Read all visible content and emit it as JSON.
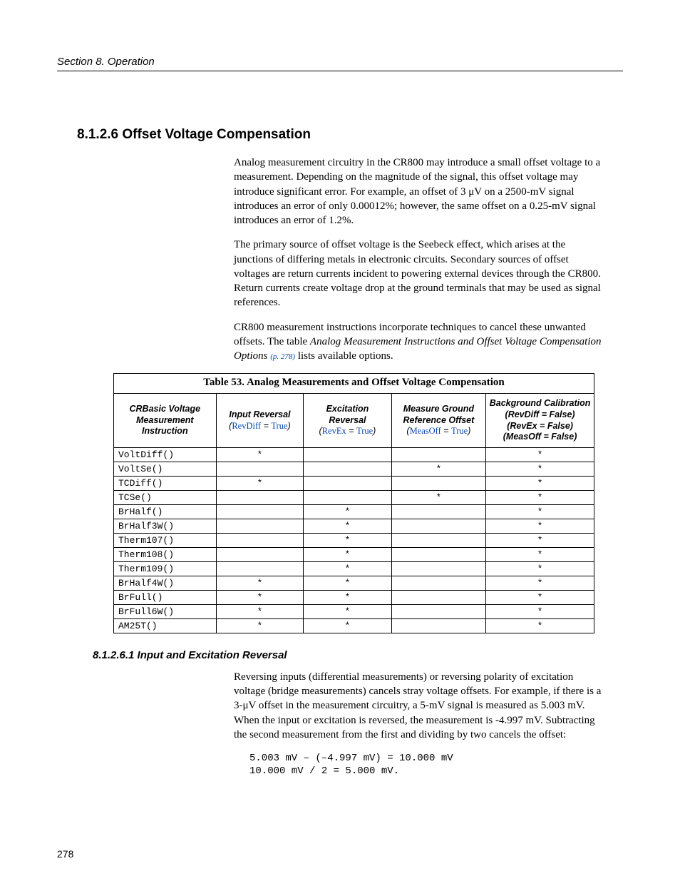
{
  "header": "Section 8.  Operation",
  "page_number": "278",
  "section_heading": "8.1.2.6 Offset Voltage Compensation",
  "paragraphs": {
    "p1": "Analog measurement circuitry in the CR800 may introduce a small offset voltage to a measurement. Depending on the magnitude of the signal, this offset voltage may introduce significant error. For example, an offset of 3 μV on a 2500-mV signal introduces an error of only 0.00012%; however, the same offset on a 0.25-mV signal introduces an error of 1.2%.",
    "p2": "The primary source of offset voltage is the Seebeck effect, which arises at the junctions of differing metals in electronic circuits. Secondary sources of offset voltages are return currents incident to powering external devices through the CR800. Return currents create voltage drop at the ground terminals that may be used as signal references.",
    "p3_a": "CR800 measurement instructions incorporate techniques to cancel these unwanted offsets. The table ",
    "p3_ital": "Analog Measurement Instructions and Offset Voltage Compensation Options ",
    "p3_link": "(p. 278)",
    "p3_b": " lists available options."
  },
  "table": {
    "caption": "Table 53. Analog Measurements and Offset Voltage Compensation",
    "headers": {
      "c0": "CRBasic Voltage Measurement Instruction",
      "c1_title": "Input Reversal",
      "c1_param_open": "(",
      "c1_param_name": "RevDiff",
      "c1_param_eq": " = ",
      "c1_param_val": "True",
      "c1_param_close": ")",
      "c2_title": "Excitation Reversal",
      "c2_param_open": "(",
      "c2_param_name": "RevEx",
      "c2_param_eq": " = ",
      "c2_param_val": "True",
      "c2_param_close": ")",
      "c3_title": "Measure Ground Reference Offset",
      "c3_param_open": "(",
      "c3_param_name": "MeasOff",
      "c3_param_eq": " = ",
      "c3_param_val": "True",
      "c3_param_close": ")",
      "c4_l1": "Background Calibration",
      "c4_l2": "(RevDiff = False)",
      "c4_l3": "(RevEx = False)",
      "c4_l4": "(MeasOff = False)"
    },
    "mark": "*",
    "rows": [
      {
        "instr": "VoltDiff()",
        "a": "*",
        "b": "",
        "c": "",
        "d": "*"
      },
      {
        "instr": "VoltSe()",
        "a": "",
        "b": "",
        "c": "*",
        "d": "*"
      },
      {
        "instr": "TCDiff()",
        "a": "*",
        "b": "",
        "c": "",
        "d": "*"
      },
      {
        "instr": "TCSe()",
        "a": "",
        "b": "",
        "c": "*",
        "d": "*"
      },
      {
        "instr": "BrHalf()",
        "a": "",
        "b": "*",
        "c": "",
        "d": "*"
      },
      {
        "instr": "BrHalf3W()",
        "a": "",
        "b": "*",
        "c": "",
        "d": "*"
      },
      {
        "instr": "Therm107()",
        "a": "",
        "b": "*",
        "c": "",
        "d": "*"
      },
      {
        "instr": "Therm108()",
        "a": "",
        "b": "*",
        "c": "",
        "d": "*"
      },
      {
        "instr": "Therm109()",
        "a": "",
        "b": "*",
        "c": "",
        "d": "*"
      },
      {
        "instr": "BrHalf4W()",
        "a": "*",
        "b": "*",
        "c": "",
        "d": "*"
      },
      {
        "instr": "BrFull()",
        "a": "*",
        "b": "*",
        "c": "",
        "d": "*"
      },
      {
        "instr": "BrFull6W()",
        "a": "*",
        "b": "*",
        "c": "",
        "d": "*"
      },
      {
        "instr": "AM25T()",
        "a": "*",
        "b": "*",
        "c": "",
        "d": "*"
      }
    ]
  },
  "subsection_heading": "8.1.2.6.1 Input and Excitation Reversal",
  "sub_paragraph": "Reversing inputs (differential measurements) or reversing polarity of excitation voltage (bridge measurements) cancels stray voltage offsets. For example, if there is a 3-μV offset in the measurement circuitry, a 5-mV signal is measured as 5.003 mV. When the input or excitation is reversed, the measurement is -4.997 mV. Subtracting the second measurement from the first and dividing by two cancels the offset:",
  "code": "5.003 mV – (–4.997 mV) = 10.000 mV\n10.000 mV / 2 = 5.000 mV."
}
